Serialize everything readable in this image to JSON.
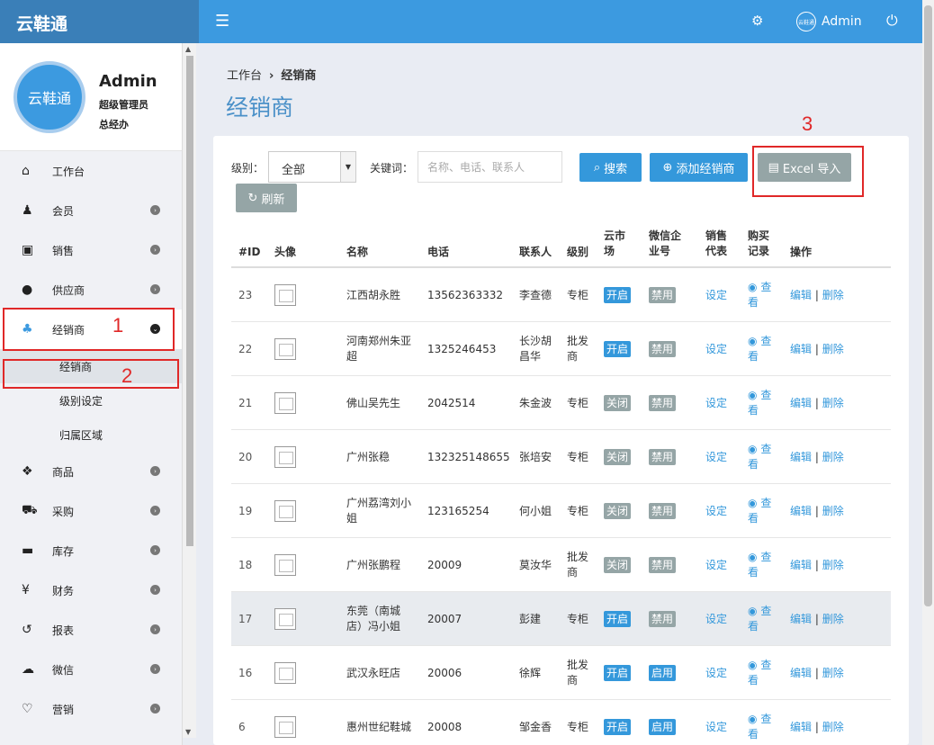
{
  "app": {
    "brand": "云鞋通"
  },
  "topbar": {
    "user_name": "Admin",
    "avatar_text": "云鞋通"
  },
  "profile": {
    "logo_text": "云鞋通",
    "name": "Admin",
    "role": "超级管理员",
    "title": "总经办"
  },
  "sidebar": {
    "items": [
      {
        "label": "工作台",
        "icon": "home-icon"
      },
      {
        "label": "会员",
        "icon": "person-icon"
      },
      {
        "label": "销售",
        "icon": "money-icon"
      },
      {
        "label": "供应商",
        "icon": "user-icon"
      },
      {
        "label": "经销商",
        "icon": "users-icon"
      },
      {
        "label": "商品",
        "icon": "cubes-icon"
      },
      {
        "label": "采购",
        "icon": "cart-icon"
      },
      {
        "label": "库存",
        "icon": "archive-icon"
      },
      {
        "label": "财务",
        "icon": "yen-icon"
      },
      {
        "label": "报表",
        "icon": "history-icon"
      },
      {
        "label": "微信",
        "icon": "wechat-icon"
      },
      {
        "label": "营销",
        "icon": "bulb-icon"
      }
    ],
    "sub_items": [
      "经销商",
      "级别设定",
      "归属区域"
    ]
  },
  "annotations": [
    "1",
    "2",
    "3"
  ],
  "breadcrumb": {
    "home": "工作台",
    "current": "经销商"
  },
  "page_title": "经销商",
  "filters": {
    "level_label": "级别：",
    "level_value": "全部",
    "keyword_label": "关键词：",
    "keyword_placeholder": "名称、电话、联系人"
  },
  "buttons": {
    "search": "搜索",
    "add": "添加经销商",
    "excel": "Excel 导入",
    "refresh": "刷新"
  },
  "table": {
    "headers": {
      "id": "#ID",
      "avatar": "头像",
      "name": "名称",
      "phone": "电话",
      "contact": "联系人",
      "level": "级别",
      "cloud1": "云市",
      "cloud2": "场",
      "wx1": "微信企",
      "wx2": "业号",
      "sales1": "销售",
      "sales2": "代表",
      "buy1": "购买",
      "buy2": "记录",
      "ops": "操作"
    },
    "set_label": "设定",
    "view1": "查",
    "view2": "看",
    "edit": "编辑",
    "delete": "删除",
    "rows": [
      {
        "id": "23",
        "name1": "江西胡永胜",
        "name2": "",
        "phone": "13562363332",
        "contact1": "李查德",
        "contact2": "",
        "level1": "专柜",
        "level2": "",
        "cloud": "开启",
        "wx": "禁用"
      },
      {
        "id": "22",
        "name1": "河南郑州朱亚",
        "name2": "超",
        "phone": "1325246453",
        "contact1": "长沙胡",
        "contact2": "昌华",
        "level1": "批发",
        "level2": "商",
        "cloud": "开启",
        "wx": "禁用"
      },
      {
        "id": "21",
        "name1": "佛山吴先生",
        "name2": "",
        "phone": "2042514",
        "contact1": "朱金波",
        "contact2": "",
        "level1": "专柜",
        "level2": "",
        "cloud": "关闭",
        "wx": "禁用"
      },
      {
        "id": "20",
        "name1": "广州张稳",
        "name2": "",
        "phone": "132325148655",
        "contact1": "张培安",
        "contact2": "",
        "level1": "专柜",
        "level2": "",
        "cloud": "关闭",
        "wx": "禁用"
      },
      {
        "id": "19",
        "name1": "广州荔湾刘小",
        "name2": "姐",
        "phone": "123165254",
        "contact1": "何小姐",
        "contact2": "",
        "level1": "专柜",
        "level2": "",
        "cloud": "关闭",
        "wx": "禁用"
      },
      {
        "id": "18",
        "name1": "广州张鹏程",
        "name2": "",
        "phone": "20009",
        "contact1": "莫汝华",
        "contact2": "",
        "level1": "批发",
        "level2": "商",
        "cloud": "关闭",
        "wx": "禁用"
      },
      {
        "id": "17",
        "name1": "东莞（南城",
        "name2": "店）冯小姐",
        "phone": "20007",
        "contact1": "彭建",
        "contact2": "",
        "level1": "专柜",
        "level2": "",
        "cloud": "开启",
        "wx": "禁用"
      },
      {
        "id": "16",
        "name1": "武汉永旺店",
        "name2": "",
        "phone": "20006",
        "contact1": "徐辉",
        "contact2": "",
        "level1": "批发",
        "level2": "商",
        "cloud": "开启",
        "wx": "启用"
      },
      {
        "id": "6",
        "name1": "惠州世纪鞋城",
        "name2": "",
        "phone": "20008",
        "contact1": "邹金香",
        "contact2": "",
        "level1": "专柜",
        "level2": "",
        "cloud": "开启",
        "wx": "启用"
      }
    ]
  },
  "colors": {
    "accent": "#3c9ae0",
    "brand_bar": "#3a7fb8",
    "annotation": "#e02828",
    "muted_button": "#95a5a6"
  }
}
